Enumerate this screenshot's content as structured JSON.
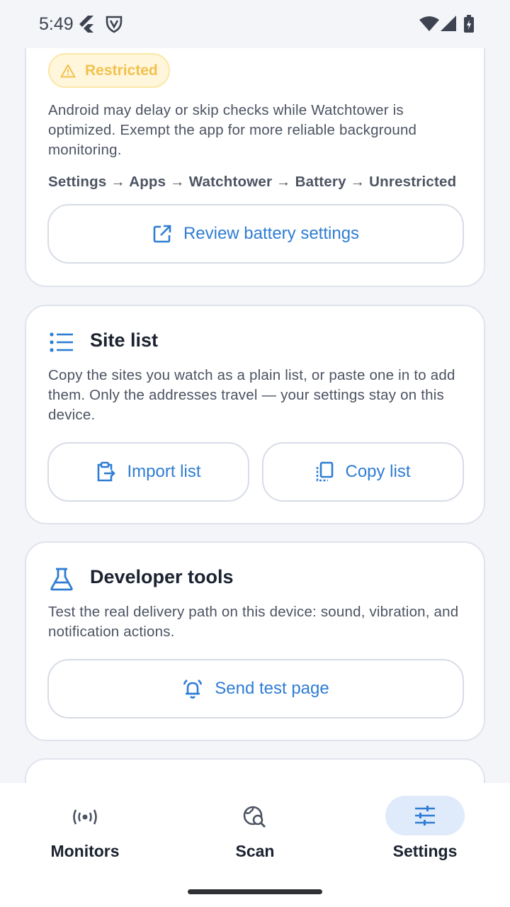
{
  "status_bar": {
    "time": "5:49",
    "left_icons": [
      "flutter-icon",
      "vpn-shield-icon"
    ],
    "right_icons": [
      "wifi-icon",
      "cellular-icon",
      "battery-charging-icon"
    ]
  },
  "battery_card": {
    "badge": "Restricted",
    "description": "Android may delay or skip checks while Watchtower is optimized. Exempt the app for more reliable background monitoring.",
    "path": "Settings → Apps → Watchtower → Battery → Unrestricted",
    "button_label": "Review battery settings",
    "button_icon": "open-external-icon"
  },
  "site_list_card": {
    "title": "Site list",
    "icon": "list-icon",
    "description": "Copy the sites you watch as a plain list, or paste one in to add them. Only the addresses travel — your settings stay on this device.",
    "import_label": "Import list",
    "copy_label": "Copy list"
  },
  "developer_tools_card": {
    "title": "Developer tools",
    "icon": "flask-icon",
    "description": "Test the real delivery path on this device: sound, vibration, and notification actions.",
    "button_label": "Send test page",
    "button_icon": "alarm-bell-icon"
  },
  "bottom_nav": {
    "items": [
      {
        "label": "Monitors",
        "icon": "broadcast-icon",
        "active": false
      },
      {
        "label": "Scan",
        "icon": "globe-search-icon",
        "active": false
      },
      {
        "label": "Settings",
        "icon": "sliders-icon",
        "active": true
      }
    ]
  },
  "colors": {
    "accent": "#2f7dd3",
    "warning_badge_bg": "#fff6dc",
    "warning_text": "#f2c14d",
    "active_nav_bg": "#dfeafb"
  }
}
